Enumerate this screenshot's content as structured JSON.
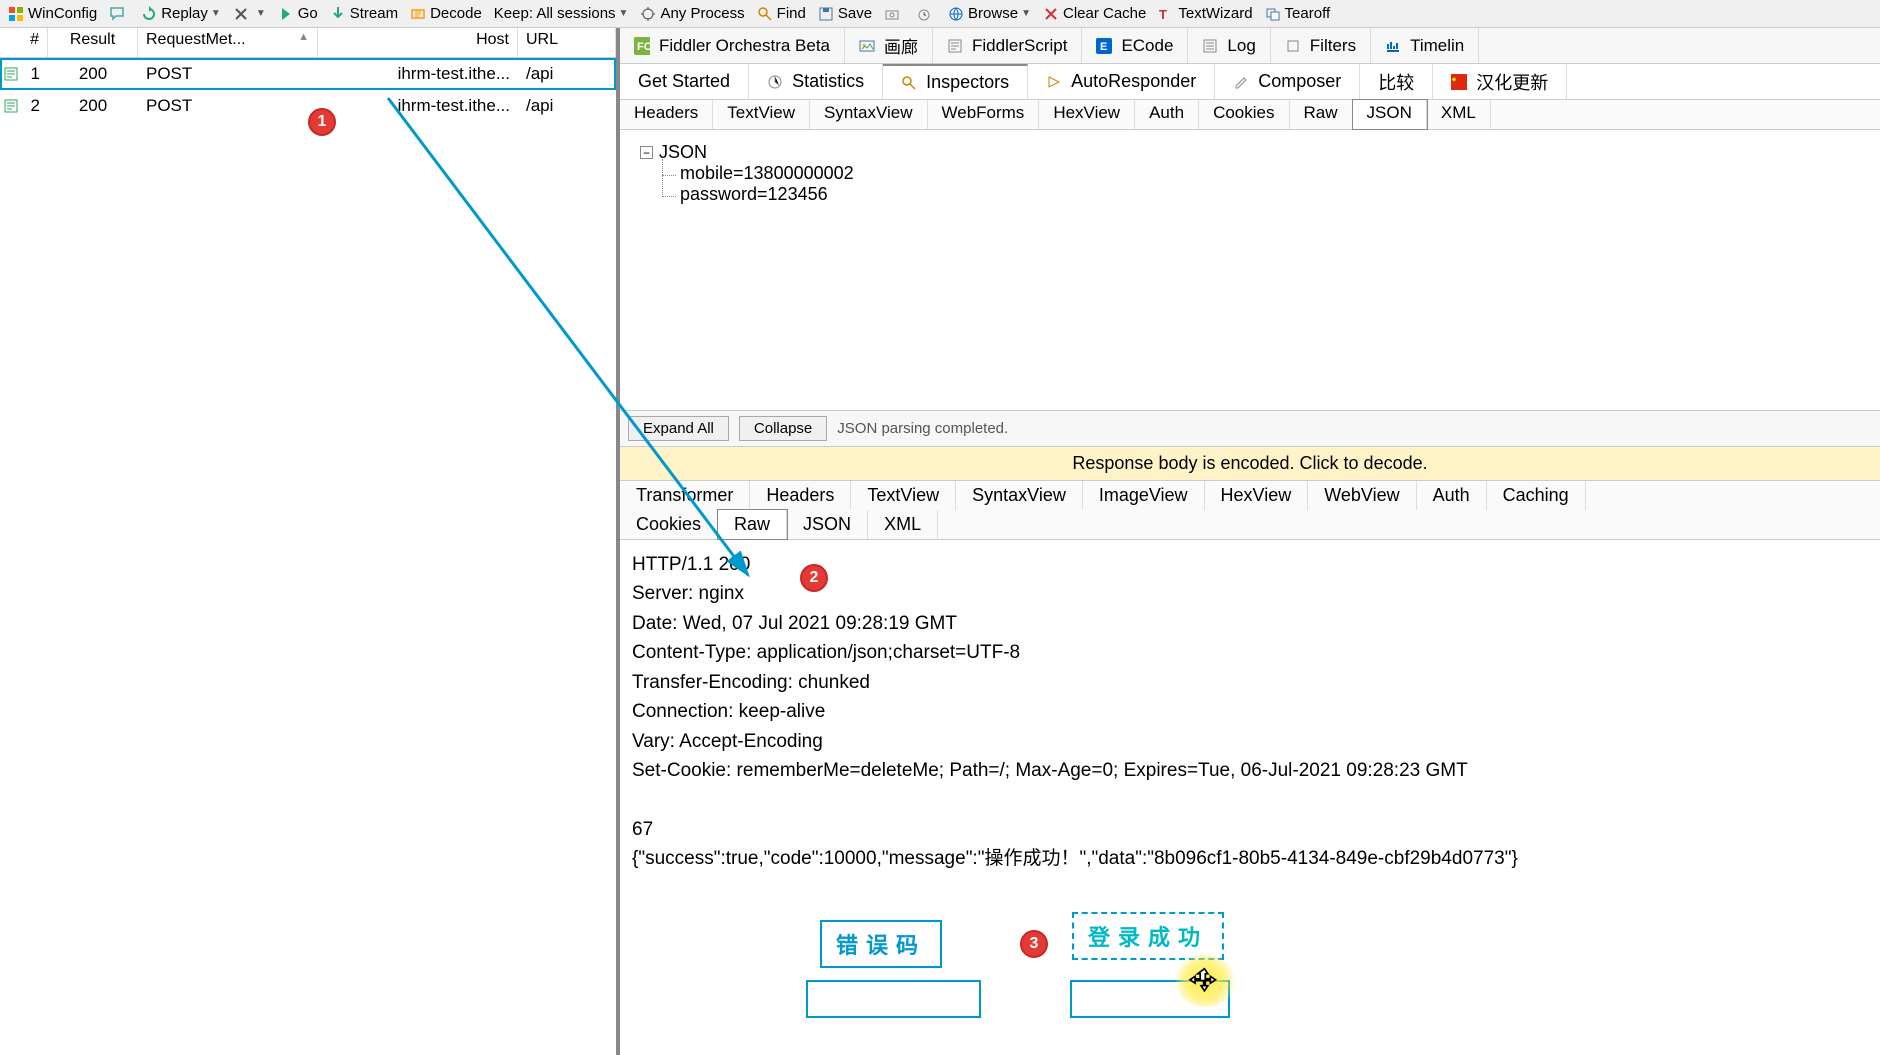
{
  "toolbar": {
    "winconfig": "WinConfig",
    "replay": "Replay",
    "go": "Go",
    "stream": "Stream",
    "decode": "Decode",
    "keep": "Keep: All sessions",
    "anyprocess": "Any Process",
    "find": "Find",
    "save": "Save",
    "browse": "Browse",
    "clearcache": "Clear Cache",
    "textwizard": "TextWizard",
    "tearoff": "Tearoff"
  },
  "sessions": {
    "headers": {
      "num": "#",
      "result": "Result",
      "method": "RequestMet...",
      "host": "Host",
      "url": "URL"
    },
    "rows": [
      {
        "num": "1",
        "result": "200",
        "method": "POST",
        "host": "ihrm-test.ithe...",
        "url": "/api"
      },
      {
        "num": "2",
        "result": "200",
        "method": "POST",
        "host": "ihrm-test.ithe...",
        "url": "/api"
      }
    ]
  },
  "rightTabs1": {
    "orchestra": "Fiddler Orchestra Beta",
    "gallery": "画廊",
    "fscript": "FiddlerScript",
    "ecode": "ECode",
    "log": "Log",
    "filters": "Filters",
    "timeline": "Timelin"
  },
  "rightTabs2": {
    "getstarted": "Get Started",
    "statistics": "Statistics",
    "inspectors": "Inspectors",
    "autoresponder": "AutoResponder",
    "composer": "Composer",
    "compare": "比较",
    "l10n": "汉化更新"
  },
  "reqTabs": {
    "headers": "Headers",
    "textview": "TextView",
    "syntaxview": "SyntaxView",
    "webforms": "WebForms",
    "hexview": "HexView",
    "auth": "Auth",
    "cookies": "Cookies",
    "raw": "Raw",
    "json": "JSON",
    "xml": "XML"
  },
  "jsonTree": {
    "root": "JSON",
    "mobile": "mobile=13800000002",
    "password": "password=123456"
  },
  "treeActions": {
    "expand": "Expand All",
    "collapse": "Collapse",
    "status": "JSON parsing completed."
  },
  "encodedBar": "Response body is encoded. Click to decode.",
  "respTabsRow1": {
    "transformer": "Transformer",
    "headers": "Headers",
    "textview": "TextView",
    "syntaxview": "SyntaxView",
    "imageview": "ImageView",
    "hexview": "HexView",
    "webview": "WebView",
    "auth": "Auth",
    "caching": "Caching"
  },
  "respTabsRow2": {
    "cookies": "Cookies",
    "raw": "Raw",
    "json": "JSON",
    "xml": "XML"
  },
  "rawResponse": "HTTP/1.1 200\nServer: nginx\nDate: Wed, 07 Jul 2021 09:28:19 GMT\nContent-Type: application/json;charset=UTF-8\nTransfer-Encoding: chunked\nConnection: keep-alive\nVary: Accept-Encoding\nSet-Cookie: rememberMe=deleteMe; Path=/; Max-Age=0; Expires=Tue, 06-Jul-2021 09:28:23 GMT\n\n67\n{\"success\":true,\"code\":10000,\"message\":\"操作成功！\",\"data\":\"8b096cf1-80b5-4134-849e-cbf29b4d0773\"}",
  "annotations": {
    "errcode": "错误码",
    "loginok": "登录成功",
    "b1": "1",
    "b2": "2",
    "b3": "3"
  }
}
